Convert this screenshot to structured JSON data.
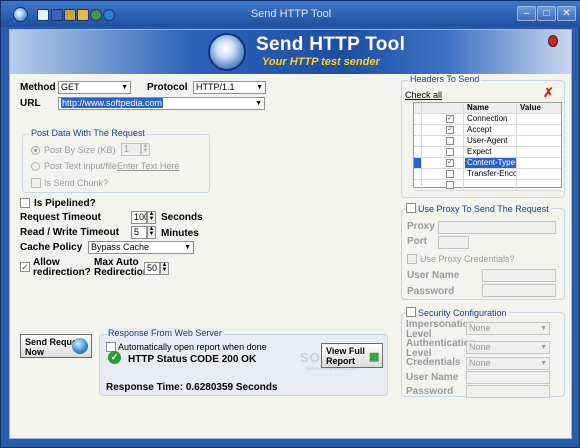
{
  "window": {
    "title": "Send HTTP Tool"
  },
  "banner": {
    "title": "Send HTTP Tool",
    "subtitle": "Your HTTP test sender"
  },
  "request": {
    "method_label": "Method",
    "method_value": "GET",
    "protocol_label": "Protocol",
    "protocol_value": "HTTP/1.1",
    "url_label": "URL",
    "url_value": "http://www.softpedia.com"
  },
  "post_data": {
    "group_title": "Post Data With The Request",
    "post_by_size_label": "Post By Size (KB)",
    "post_size_value": "1",
    "post_text_label": "Post Text input/file",
    "enter_text_link": "Enter Text Here",
    "send_chunk_label": "Is Send Chunk?"
  },
  "options": {
    "pipelined_label": "Is Pipelined?",
    "request_timeout_label": "Request Timeout",
    "request_timeout_value": "100",
    "request_timeout_unit": "Seconds",
    "rw_timeout_label": "Read / Write Timeout",
    "rw_timeout_value": "5",
    "rw_timeout_unit": "Minutes",
    "cache_policy_label": "Cache Policy",
    "cache_policy_value": "Bypass Cache",
    "allow_redirection_label_1": "Allow",
    "allow_redirection_label_2": "redirection?",
    "max_redirection_label_1": "Max Auto",
    "max_redirection_label_2": "Redirection",
    "max_redirection_value": "50"
  },
  "headers": {
    "group_title": "Headers To Send",
    "check_all_label": "Check all",
    "col_name": "Name",
    "col_value": "Value",
    "rows": [
      {
        "name": "Connection",
        "value": "",
        "checked": true,
        "selected": false
      },
      {
        "name": "Accept",
        "value": "",
        "checked": true,
        "selected": false
      },
      {
        "name": "User-Agent",
        "value": "",
        "checked": false,
        "selected": false
      },
      {
        "name": "Expect",
        "value": "",
        "checked": false,
        "selected": false
      },
      {
        "name": "Content-Type",
        "value": "",
        "checked": true,
        "selected": true
      },
      {
        "name": "Transfer-Enco...",
        "value": "",
        "checked": false,
        "selected": false
      },
      {
        "name": "",
        "value": "",
        "checked": false,
        "selected": false
      }
    ]
  },
  "proxy": {
    "group_title": "Use Proxy To Send The Request",
    "proxy_label": "Proxy",
    "port_label": "Port",
    "use_credentials_label": "Use Proxy Credentials?",
    "username_label": "User Name",
    "password_label": "Password"
  },
  "security": {
    "group_title": "Security Configuration",
    "impersonation_label_1": "Impersonation",
    "impersonation_label_2": "Level",
    "impersonation_value": "None",
    "authentication_label_1": "Authentication",
    "authentication_label_2": "Level",
    "authentication_value": "None",
    "credentials_label": "Credentials",
    "credentials_value": "None",
    "username_label": "User Name",
    "password_label": "Password"
  },
  "actions": {
    "send_request_line1": "Send Request",
    "send_request_line2": "Now"
  },
  "response": {
    "group_title": "Response From Web Server",
    "auto_open_label": "Automatically open report when done",
    "status_text": "HTTP Status CODE 200 OK",
    "view_report_line1": "View Full",
    "view_report_line2": "Report",
    "response_time_text": "Response Time: 0.6280359 Seconds"
  },
  "watermark": {
    "text": "SOFTPEDIA",
    "sub": "www.softpedia.com"
  },
  "colors": {
    "accent": "#2a5aa8",
    "banner_subtitle": "#ffd21c",
    "selection": "#2a62c8",
    "status_ok": "#2d9b34"
  }
}
